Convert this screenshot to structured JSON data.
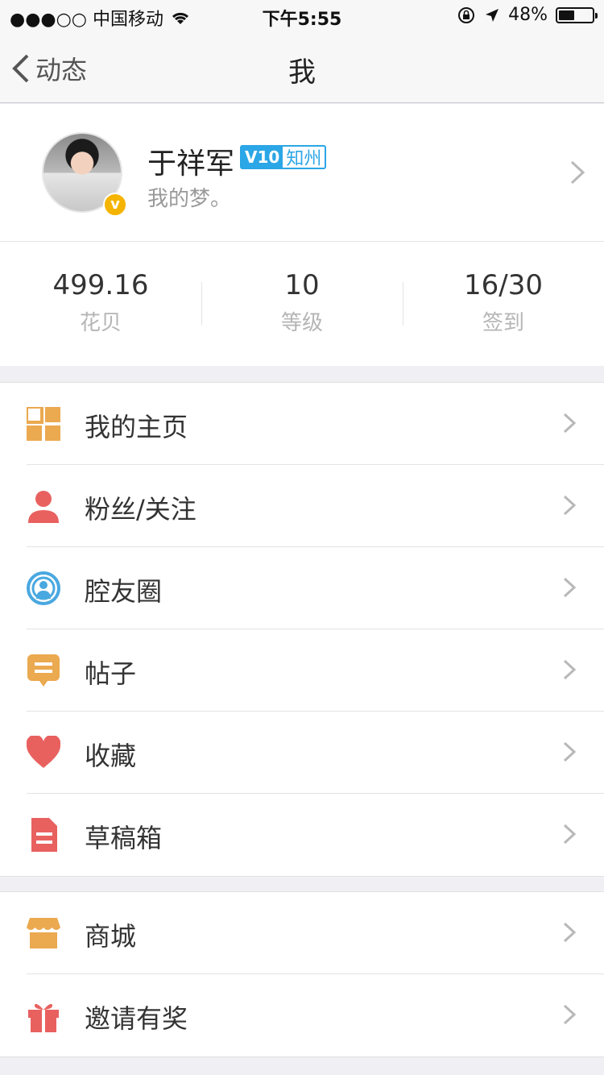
{
  "status_bar": {
    "carrier": "●●●○○ 中国移动",
    "time": "下午5:55",
    "battery_percent": "48%",
    "battery_level": 0.48
  },
  "nav": {
    "back_label": "动态",
    "title": "我"
  },
  "profile": {
    "name": "于祥军",
    "vip_level": "V10",
    "location": "知州",
    "signature": "我的梦。",
    "badge": "v"
  },
  "stats": [
    {
      "value": "499.16",
      "label": "花贝"
    },
    {
      "value": "10",
      "label": "等级"
    },
    {
      "value": "16/30",
      "label": "签到"
    }
  ],
  "menu_group_1": [
    {
      "label": "我的主页",
      "icon": "grid-icon",
      "color": "#eba950"
    },
    {
      "label": "粉丝/关注",
      "icon": "person-icon",
      "color": "#e8615f"
    },
    {
      "label": "腔友圈",
      "icon": "circle-person-icon",
      "color": "#4aa8e0"
    },
    {
      "label": "帖子",
      "icon": "message-icon",
      "color": "#eba950"
    },
    {
      "label": "收藏",
      "icon": "heart-icon",
      "color": "#e8615f"
    },
    {
      "label": "草稿箱",
      "icon": "document-icon",
      "color": "#e8615f"
    }
  ],
  "menu_group_2": [
    {
      "label": "商城",
      "icon": "store-icon",
      "color": "#eba950"
    },
    {
      "label": "邀请有奖",
      "icon": "gift-icon",
      "color": "#e8615f"
    }
  ]
}
